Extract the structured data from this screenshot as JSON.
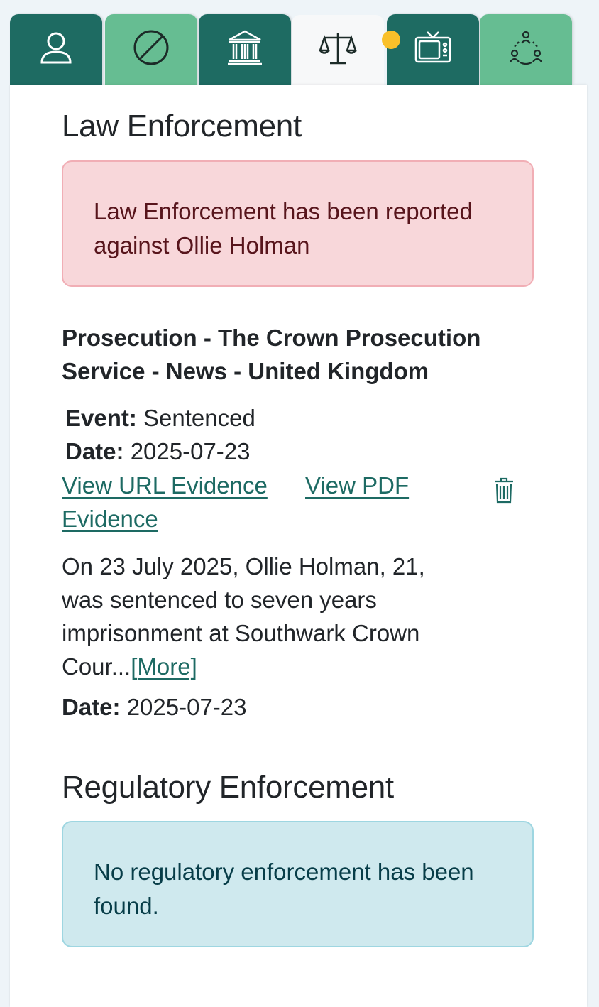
{
  "tabs": [
    {
      "name": "profile-tab",
      "icon": "person-icon",
      "variant": "dark",
      "active": false
    },
    {
      "name": "sanctions-tab",
      "icon": "prohibited-icon",
      "variant": "light",
      "active": false
    },
    {
      "name": "institution-tab",
      "icon": "bank-icon",
      "variant": "dark",
      "active": false
    },
    {
      "name": "law-tab",
      "icon": "scales-icon",
      "variant": "active",
      "active": true,
      "has_notification": true
    },
    {
      "name": "media-tab",
      "icon": "tv-icon",
      "variant": "dark",
      "active": false
    },
    {
      "name": "network-tab",
      "icon": "network-icon",
      "variant": "light",
      "active": false
    }
  ],
  "colors": {
    "tab_dark": "#1e6b62",
    "tab_light": "#66bd92",
    "notification_dot": "#f9c02a",
    "link": "#1d6a63"
  },
  "law": {
    "heading": "Law Enforcement",
    "alert_text": "Law Enforcement has been reported against Ollie Holman",
    "record": {
      "source_title": "Prosecution - The Crown Prosecution Service - News - United Kingdom",
      "event_label": "Event:",
      "event_value": "Sentenced",
      "date_label": "Date:",
      "date_value": "2025-07-23",
      "url_link": "View URL Evidence",
      "pdf_link": "View PDF Evidence",
      "delete_icon": "trash-icon",
      "summary": "On 23 July 2025, Ollie Holman, 21, was sentenced to seven years imprisonment at Southwark Crown Cour...",
      "more_link": "[More]",
      "footer_date_label": "Date:",
      "footer_date_value": "2025-07-23"
    }
  },
  "regulatory": {
    "heading": "Regulatory Enforcement",
    "info_text": "No regulatory enforcement has been found."
  }
}
